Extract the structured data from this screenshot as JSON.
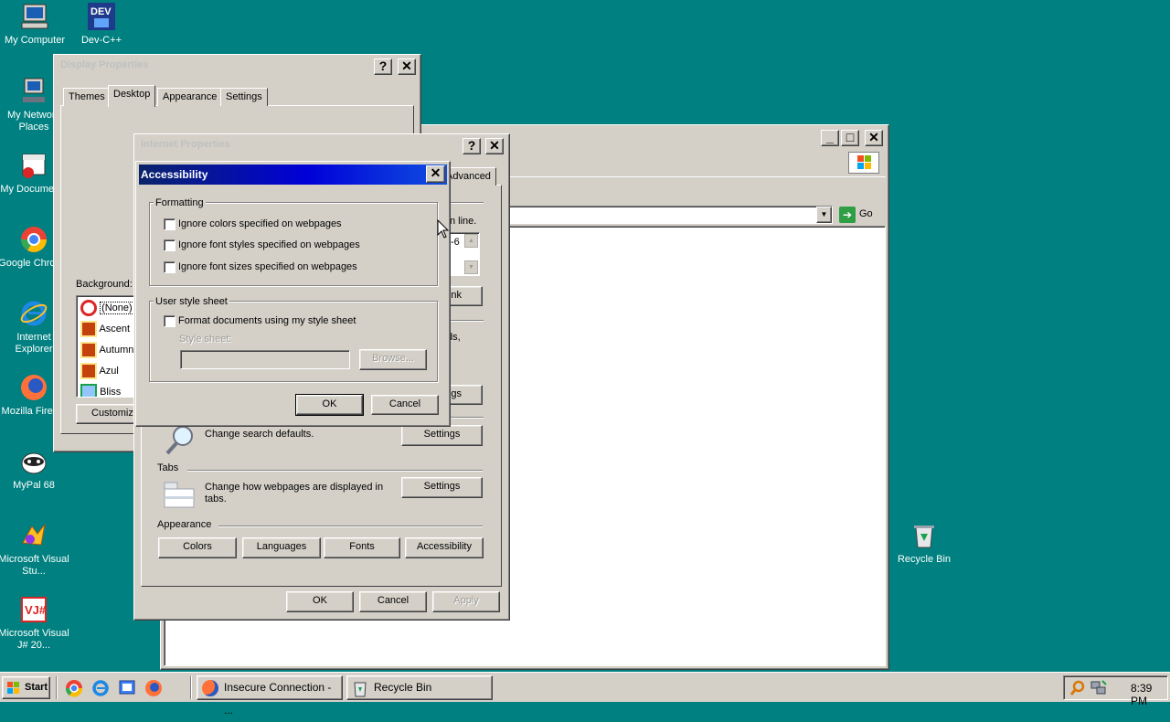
{
  "desktop": {
    "icons": [
      {
        "label": "My Computer"
      },
      {
        "label": "Dev-C++"
      },
      {
        "label": "My Network Places"
      },
      {
        "label": "My Documents"
      },
      {
        "label": "Google Chrome"
      },
      {
        "label": "Internet Explorer"
      },
      {
        "label": "Mozilla Firefox"
      },
      {
        "label": "MyPal 68"
      },
      {
        "label": "Microsoft Visual Stu..."
      },
      {
        "label": "Microsoft Visual J# 20..."
      },
      {
        "label": "Recycle Bin"
      }
    ],
    "background_color": "#008080"
  },
  "display_properties": {
    "title": "Display Properties",
    "tabs": [
      "Themes",
      "Desktop",
      "Appearance",
      "Settings"
    ],
    "active_tab": "Desktop",
    "background_label": "Background:",
    "backgrounds": [
      "(None)",
      "Ascent",
      "Autumn",
      "Azul",
      "Bliss"
    ],
    "customize_label": "Customize"
  },
  "browser_window": {
    "go_label": "Go"
  },
  "internet_properties": {
    "title": "Internet Properties",
    "visible_tab_fragment": "Advanced",
    "homepage_fragment": "n line.",
    "homepage_value_fragment": "-6",
    "button_fragment": "nk",
    "text_fragment": "ds,",
    "settings_fragment": "gs",
    "search_desc": "Change search defaults.",
    "search_settings": "Settings",
    "tabs_heading": "Tabs",
    "tabs_desc": "Change how webpages are displayed in tabs.",
    "tabs_settings": "Settings",
    "appearance_heading": "Appearance",
    "appearance_buttons": [
      "Colors",
      "Languages",
      "Fonts",
      "Accessibility"
    ],
    "ok": "OK",
    "cancel": "Cancel",
    "apply": "Apply"
  },
  "accessibility": {
    "title": "Accessibility",
    "formatting_label": "Formatting",
    "options": [
      "Ignore colors specified on webpages",
      "Ignore font styles specified on webpages",
      "Ignore font sizes specified on webpages"
    ],
    "user_style_label": "User style sheet",
    "format_docs": "Format documents using my style sheet",
    "style_sheet_label": "Style sheet:",
    "browse": "Browse...",
    "ok": "OK",
    "cancel": "Cancel"
  },
  "taskbar": {
    "start": "Start",
    "tasks": [
      "Insecure Connection - ...",
      "Recycle Bin"
    ],
    "clock": "8:39 PM"
  }
}
